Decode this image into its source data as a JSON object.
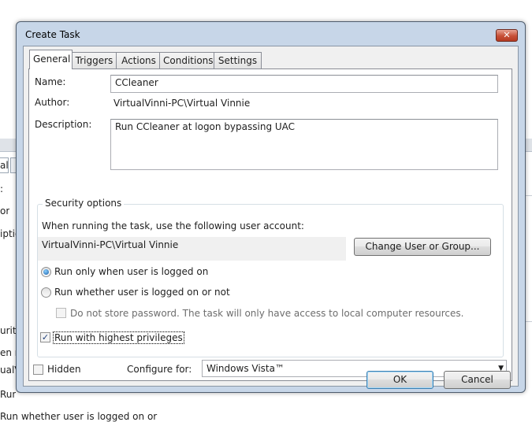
{
  "background_window": {
    "tab_fragment": "al",
    "label_fragments": [
      ":",
      "or:",
      "iptio",
      "urity",
      "en ru",
      "ualV",
      "Run"
    ],
    "bottom_text": "Run whether user is logged on or not"
  },
  "dialog": {
    "title": "Create Task",
    "close_glyph": "✕",
    "tabs": [
      "General",
      "Triggers",
      "Actions",
      "Conditions",
      "Settings"
    ],
    "active_tab": "General",
    "general": {
      "name_label": "Name:",
      "name_value": "CCleaner",
      "author_label": "Author:",
      "author_value": "VirtualVinni-PC\\Virtual Vinnie",
      "description_label": "Description:",
      "description_value": "Run CCleaner at logon bypassing UAC",
      "security": {
        "legend": "Security options",
        "account_prompt": "When running the task, use the following user account:",
        "account_value": "VirtualVinni-PC\\Virtual Vinnie",
        "change_user_button": "Change User or Group...",
        "run_logged_on_label": "Run only when user is logged on",
        "run_logged_on_checked": true,
        "run_whether_label": "Run whether user is logged on or not",
        "run_whether_checked": false,
        "no_store_password_label": "Do not store password.  The task will only have access to local computer resources.",
        "no_store_password_checked": false,
        "highest_privileges_label": "Run with highest privileges",
        "highest_privileges_checked": true
      },
      "hidden_label": "Hidden",
      "hidden_checked": false,
      "configure_label": "Configure for:",
      "configure_value": "Windows Vista™"
    },
    "ok_button": "OK",
    "cancel_button": "Cancel",
    "check_glyph": "✓",
    "dropdown_glyph": "▼"
  }
}
